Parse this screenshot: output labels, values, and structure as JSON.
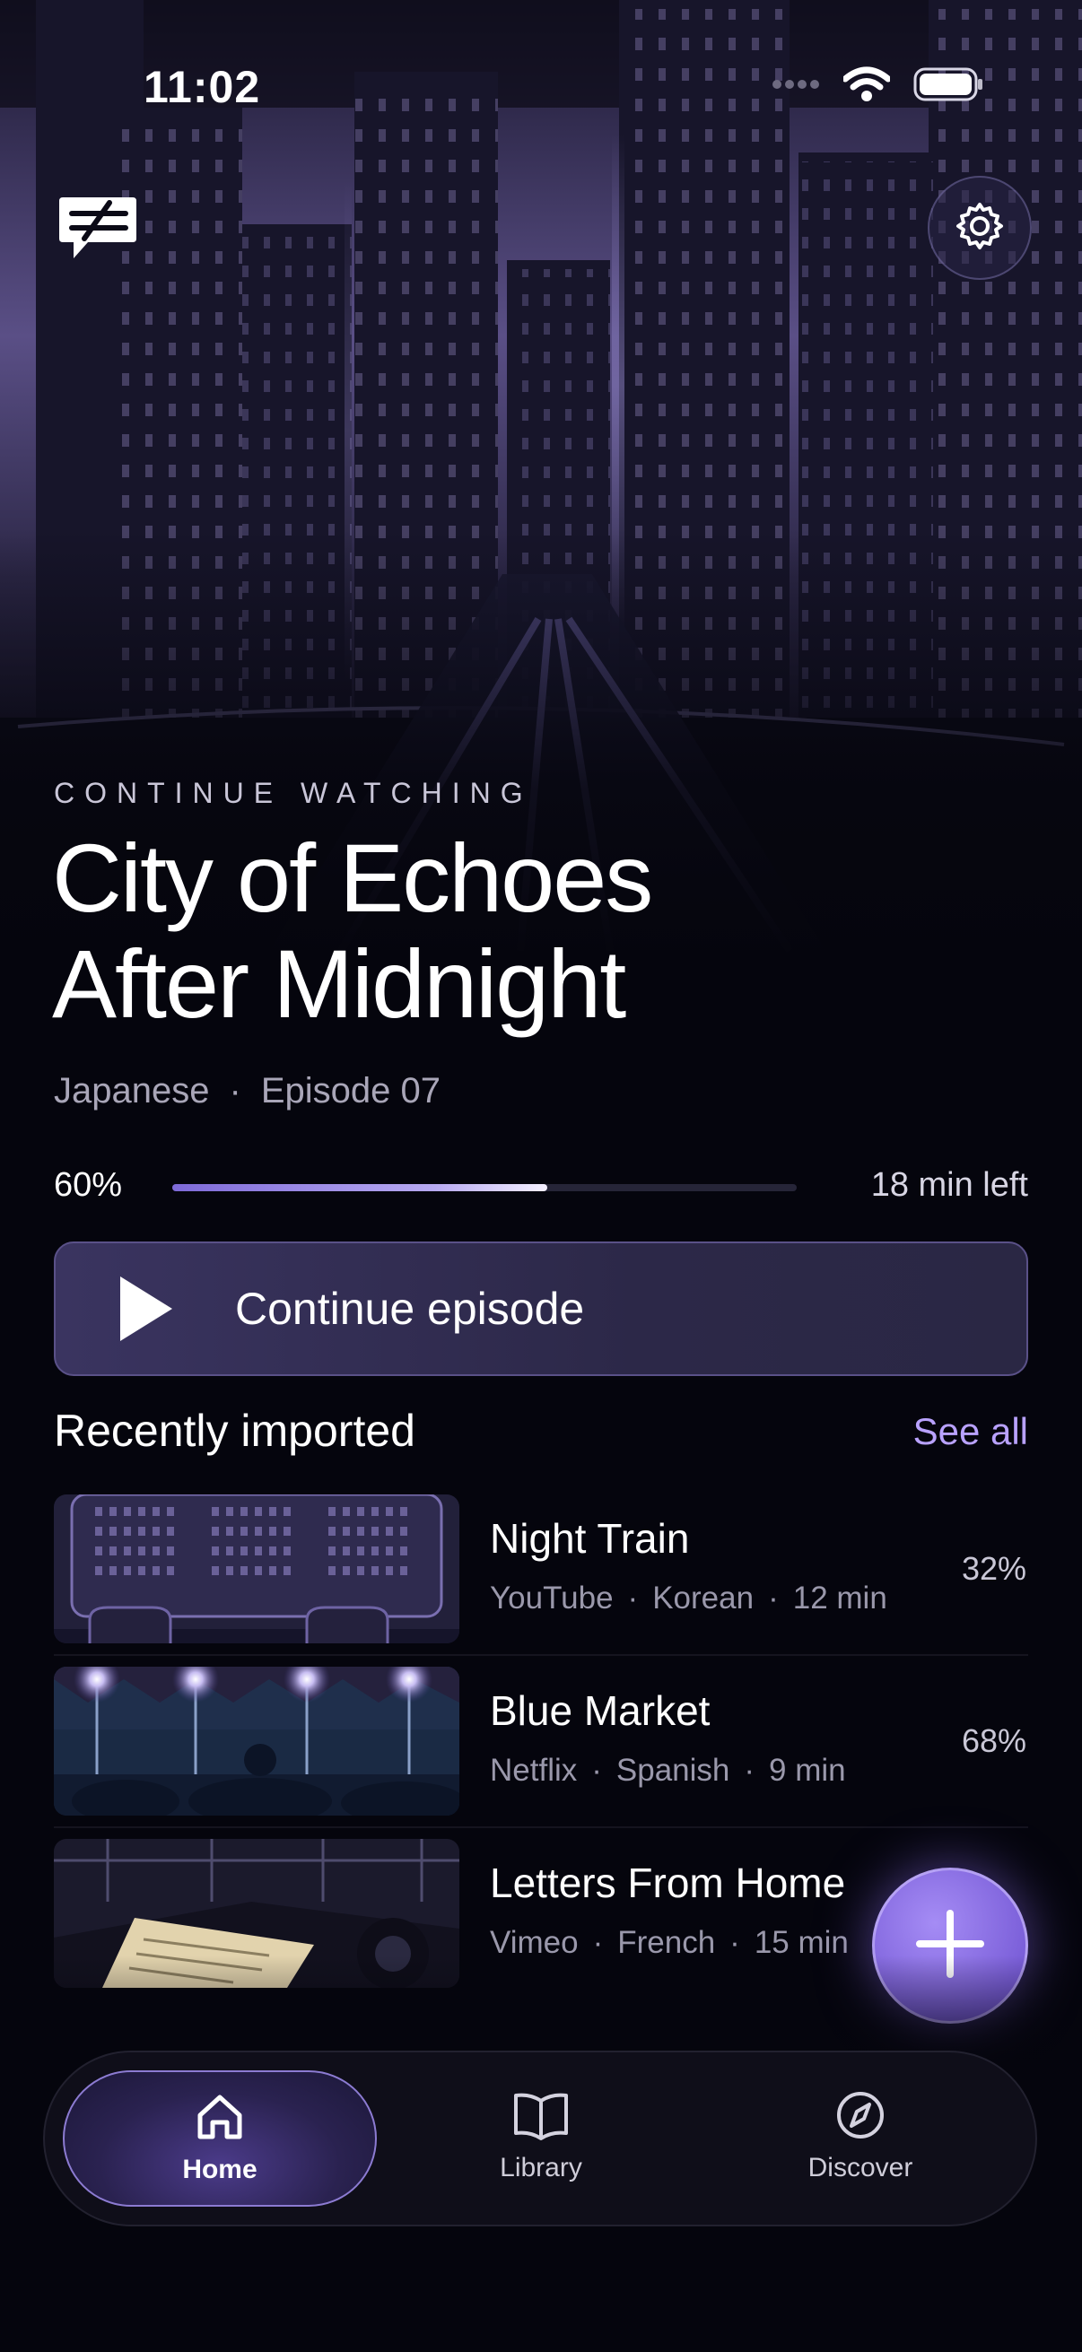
{
  "status_bar": {
    "time": "11:02",
    "icons": [
      "signal-icon",
      "wifi-icon",
      "battery-icon"
    ]
  },
  "header": {
    "logo_icon": "app-logo-icon",
    "settings_icon": "gear-icon"
  },
  "hero": {
    "eyebrow": "CONTINUE WATCHING",
    "title_line1": "City of Echoes",
    "title_line2": "After Midnight",
    "language": "Japanese",
    "episode": "Episode 07",
    "separator": "·",
    "progress_label": "60%",
    "progress_value": 0.6,
    "time_left": "18 min left",
    "continue_label": "Continue episode"
  },
  "recent": {
    "title": "Recently imported",
    "see_all": "See all",
    "items": [
      {
        "name": "Night Train",
        "source": "YouTube",
        "language": "Korean",
        "duration": "12 min",
        "progress": "32%"
      },
      {
        "name": "Blue Market",
        "source": "Netflix",
        "language": "Spanish",
        "duration": "9 min",
        "progress": "68%"
      },
      {
        "name": "Letters From Home",
        "source": "Vimeo",
        "language": "French",
        "duration": "15 min",
        "progress": ""
      }
    ]
  },
  "fab": {
    "icon": "plus-icon"
  },
  "tabs": [
    {
      "label": "Home",
      "icon": "home-icon",
      "active": true
    },
    {
      "label": "Library",
      "icon": "book-icon",
      "active": false
    },
    {
      "label": "Discover",
      "icon": "compass-icon",
      "active": false
    }
  ],
  "colors": {
    "accent": "#b9a2ff",
    "background": "#05050d",
    "fab": "#8b6fe6"
  }
}
